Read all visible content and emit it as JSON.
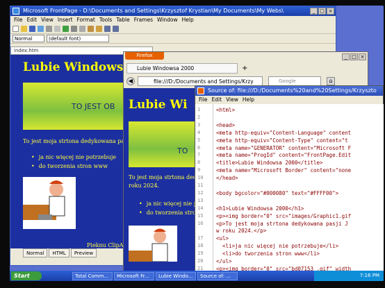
{
  "frontpage": {
    "title": "Microsoft FrontPage - D:\\Documents and Settings\\Krzysztof Krystian\\My Documents\\My Webs\\",
    "menu": [
      "File",
      "Edit",
      "View",
      "Insert",
      "Format",
      "Tools",
      "Table",
      "Frames",
      "Window",
      "Help"
    ],
    "style_select": "Normal",
    "font_select": "(default font)",
    "size_select": "Normal",
    "doc_tab": "index.htm",
    "heading": "Lubie Windowsa",
    "banner_text": "TO JEST OB",
    "paragraph": "To jest moja strtona dedykowana pas",
    "bullets": [
      "ja nic więcej nie potrzebuje",
      "do tworzenia stron www"
    ],
    "clipart_label": "Pieknu ClipArt!",
    "view_tabs": [
      "Normal",
      "HTML",
      "Preview"
    ]
  },
  "firefox": {
    "button": "Firefox",
    "tab": "Lubie Windowsa 2000",
    "new_tab": "+",
    "url": "file:///D:/Documents and Settings/Krzy",
    "search_placeholder": "Google",
    "heading": "Lubie Wi",
    "banner_text": "TO",
    "paragraph": "To jest moja strtona dedykowana pa",
    "paragraph2": "roku 2024.",
    "bullets": [
      "ja nic więcej nie p",
      "do tworzenia strom"
    ]
  },
  "source": {
    "title": "Source of: file:///D:/Documents%20and%20Settings/Krzyszto",
    "menu": [
      "File",
      "Edit",
      "View",
      "Help"
    ],
    "lines": [
      {
        "n": "1",
        "t": "<html>"
      },
      {
        "n": "2",
        "t": ""
      },
      {
        "n": "3",
        "t": "<head>"
      },
      {
        "n": "4",
        "t": "<meta http-equiv=\"Content-Language\" content"
      },
      {
        "n": "5",
        "t": "<meta http-equiv=\"Content-Type\" content=\"t"
      },
      {
        "n": "6",
        "t": "<meta name=\"GENERATOR\" content=\"Microsoft F"
      },
      {
        "n": "7",
        "t": "<meta name=\"ProgId\" content=\"FrontPage.Edit"
      },
      {
        "n": "8",
        "t": "<title>Lubie Windowsa 2000</title>"
      },
      {
        "n": "9",
        "t": "<meta name=\"Microsoft Border\" content=\"none"
      },
      {
        "n": "10",
        "t": "</head>"
      },
      {
        "n": "11",
        "t": ""
      },
      {
        "n": "12",
        "t": "<body bgcolor=\"#000080\" text=\"#FFFF00\">"
      },
      {
        "n": "13",
        "t": ""
      },
      {
        "n": "14",
        "t": "<h1>Lubie Windowsa 2000</h1>"
      },
      {
        "n": "15",
        "t": "<p><img border=\"0\" src=\"images/Graphic1.gif"
      },
      {
        "n": "16",
        "t": "<p>To jest moja strtona dedykowana pasji J"
      },
      {
        "n": "",
        "t": "w roku 2024.</p>"
      },
      {
        "n": "17",
        "t": "<ul>"
      },
      {
        "n": "18",
        "t": "  <li>ja nic więcej nie potrzebuje</li>"
      },
      {
        "n": "19",
        "t": "  <li>do tworzenia stron www</li>"
      },
      {
        "n": "20",
        "t": "</ul>"
      },
      {
        "n": "21",
        "t": "<p><img border=\"0\" src=\"bd07153_.gif\" width"
      }
    ]
  },
  "taskbar": {
    "start": "Start",
    "items": [
      "Total Comm...",
      "Microsoft Fr...",
      "Lubie Windo...",
      "Source of: ..."
    ],
    "clock": "7:16 PM"
  }
}
